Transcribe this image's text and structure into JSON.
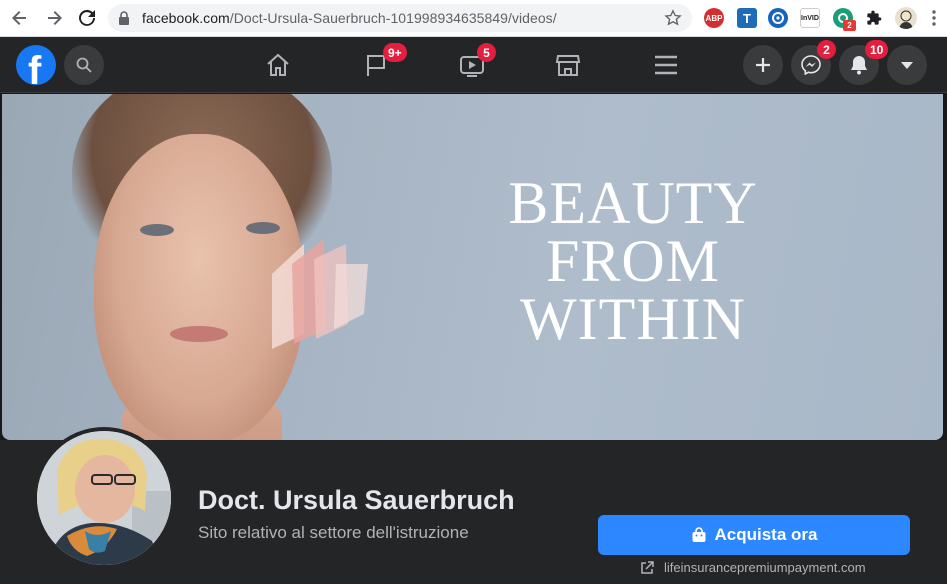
{
  "browser": {
    "url_host": "facebook.com",
    "url_path": "/Doct-Ursula-Sauerbruch-101998934635849/videos/",
    "extensions": {
      "abp_label": "ABP",
      "t_label": "T",
      "invid_label": "InVID",
      "green_badge": "2"
    }
  },
  "fb_header": {
    "pages_badge": "9+",
    "watch_badge": "5",
    "messenger_badge": "2",
    "notifications_badge": "10"
  },
  "cover": {
    "headline_line1": "BEAUTY",
    "headline_line2": "FROM",
    "headline_line3": "WITHIN"
  },
  "profile": {
    "name": "Doct. Ursula Sauerbruch",
    "category": "Sito relativo al settore dell'istruzione",
    "cta_label": "Acquista ora",
    "website": "lifeinsurancepremiumpayment.com"
  },
  "colors": {
    "fb_blue": "#1877f2",
    "cta_blue": "#2d88ff",
    "badge_red": "#e41e3f",
    "header_bg": "#242526",
    "page_bg": "#18191a"
  }
}
